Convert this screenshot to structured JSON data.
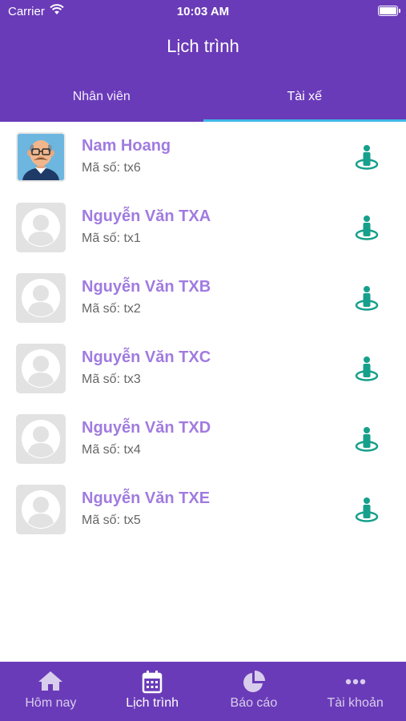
{
  "status_bar": {
    "carrier": "Carrier",
    "time": "10:03 AM"
  },
  "header": {
    "title": "Lịch trình"
  },
  "tabs": [
    {
      "label": "Nhân viên",
      "active": false
    },
    {
      "label": "Tài xế",
      "active": true
    }
  ],
  "drivers": [
    {
      "name": "Nam Hoang",
      "code": "Mã số: tx6",
      "avatar": "cartoon-man-avatar"
    },
    {
      "name": "Nguyễn Văn TXA",
      "code": "Mã số: tx1",
      "avatar": "default-person-avatar"
    },
    {
      "name": "Nguyễn Văn TXB",
      "code": "Mã số: tx2",
      "avatar": "default-person-avatar"
    },
    {
      "name": "Nguyễn Văn TXC",
      "code": "Mã số: tx3",
      "avatar": "default-person-avatar"
    },
    {
      "name": "Nguyễn Văn TXD",
      "code": "Mã số: tx4",
      "avatar": "default-person-avatar"
    },
    {
      "name": "Nguyễn Văn TXE",
      "code": "Mã số: tx5",
      "avatar": "default-person-avatar"
    }
  ],
  "bottom_nav": [
    {
      "label": "Hôm nay",
      "icon": "home-icon",
      "active": false
    },
    {
      "label": "Lịch trình",
      "icon": "calendar-icon",
      "active": true
    },
    {
      "label": "Báo cáo",
      "icon": "pie-chart-icon",
      "active": false
    },
    {
      "label": "Tài khoản",
      "icon": "more-icon",
      "active": false
    }
  ],
  "colors": {
    "primary": "#6a3bb8",
    "name_text": "#a07be0",
    "location_icon": "#16a08c",
    "tab_indicator": "#3fb7e8"
  }
}
